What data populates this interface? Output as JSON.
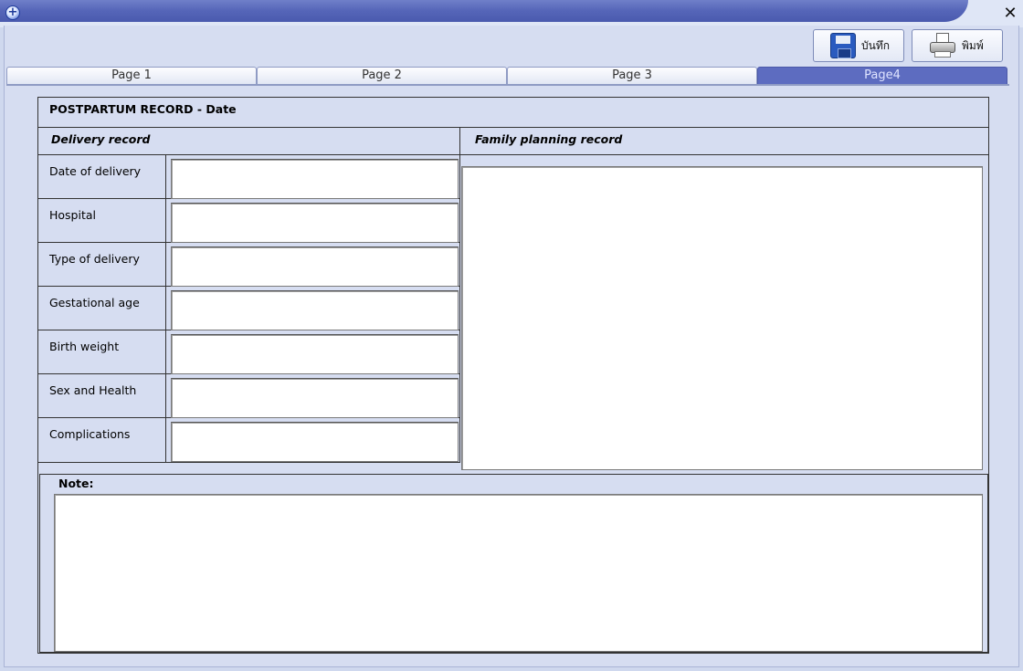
{
  "window": {
    "close_symbol": "✕",
    "app_icon": "plus-circle-icon"
  },
  "toolbar": {
    "save_label": "บันทึก",
    "save_icon": "floppy-disk-icon",
    "print_label": "พิมพ์",
    "print_icon": "printer-icon"
  },
  "tabs": [
    {
      "label": "Page 1",
      "active": false
    },
    {
      "label": "Page 2",
      "active": false
    },
    {
      "label": "Page 3",
      "active": false
    },
    {
      "label": "Page4",
      "active": true
    }
  ],
  "form": {
    "title": "POSTPARTUM RECORD - Date",
    "delivery_heading": "Delivery record",
    "family_heading": "Family planning record",
    "fields": [
      {
        "label": "Date of delivery",
        "value": ""
      },
      {
        "label": "Hospital",
        "value": ""
      },
      {
        "label": "Type of delivery",
        "value": ""
      },
      {
        "label": "Gestational age",
        "value": ""
      },
      {
        "label": "Birth weight",
        "value": ""
      },
      {
        "label": "Sex and Health",
        "value": ""
      },
      {
        "label": "Complications",
        "value": ""
      }
    ],
    "family_value": "",
    "note_label": "Note:",
    "note_value": ""
  },
  "colors": {
    "active_tab": "#5d6cc0",
    "titlebar": "#5565b8",
    "panel_bg": "#d6ddf1"
  }
}
